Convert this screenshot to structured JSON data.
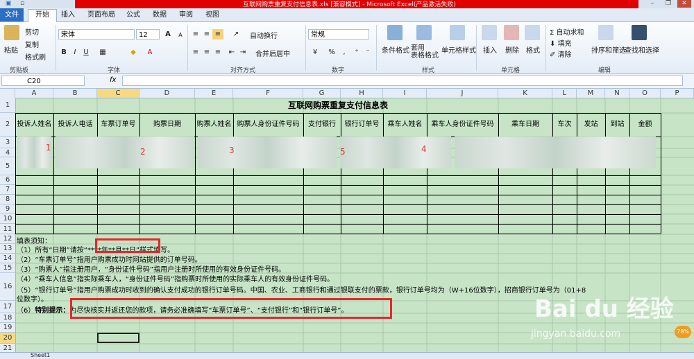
{
  "window": {
    "title": "互联网购票重复支付信息表.xls [兼容模式] - Microsoft Excel(产品激活失败)"
  },
  "tabs": [
    "文件",
    "开始",
    "插入",
    "页面布局",
    "公式",
    "数据",
    "审阅",
    "视图"
  ],
  "ribbon": {
    "clipboard": {
      "paste": "粘贴",
      "cut": "剪切",
      "copy": "复制",
      "format_painter": "格式刷",
      "label": "剪贴板"
    },
    "font": {
      "name": "宋体",
      "size": "12",
      "label": "字体",
      "bold": "B",
      "italic": "I",
      "underline": "U",
      "grow": "A",
      "shrink": "A"
    },
    "alignment": {
      "wrap": "自动换行",
      "merge": "合并后居中",
      "label": "对齐方式"
    },
    "number": {
      "format": "常规",
      "label": "数字",
      "percent": "%",
      "comma": ","
    },
    "styles": {
      "conditional": "条件格式",
      "table": "套用\n表格格式",
      "cell": "单元格样式",
      "label": "样式"
    },
    "cells": {
      "insert": "插入",
      "delete": "删除",
      "format": "格式",
      "label": "单元格"
    },
    "editing": {
      "autosum": "自动求和",
      "fill": "填充",
      "clear": "清除",
      "sort": "排序和筛选",
      "find": "查找和选择",
      "label": "编辑"
    }
  },
  "formula_bar": {
    "name_box": "C20",
    "fx": "fx",
    "value": ""
  },
  "columns": [
    "A",
    "B",
    "C",
    "D",
    "E",
    "F",
    "G",
    "H",
    "I",
    "J",
    "K",
    "L",
    "M",
    "N",
    "O",
    "P"
  ],
  "rows": [
    "1",
    "2",
    "3",
    "4",
    "5",
    "6",
    "7",
    "8",
    "9",
    "10",
    "11",
    "12",
    "13",
    "14",
    "15",
    "16",
    "17",
    "18",
    "19",
    "20",
    "21"
  ],
  "sheet": {
    "title": "互联网购票重复支付信息表",
    "headers": [
      "投诉人姓名",
      "投诉人电话",
      "车票订单号",
      "购票日期",
      "购票人姓名",
      "购票人身份证件号码",
      "支付银行",
      "银行订单号",
      "乘车人姓名",
      "乘车人身份证件号码",
      "乘车日期",
      "车次",
      "发站",
      "到站",
      "金额"
    ],
    "markers": [
      "1",
      "2",
      "3",
      "5",
      "4"
    ],
    "notes": {
      "heading": "填表须知：",
      "n1": "（1）所有“日期”请按“****年**月**日”样式填写。",
      "n2": "（2）“车票订单号”指用户购票成功时网站提供的订单号码。",
      "n3": "（3）“购票人”指注册用户，“身份证件号码”指用户注册时所使用的有效身份证件号码。",
      "n4": "（4）“乘车人信息”指实际乘车人，“身份证件号码”指购票时所使用的实际乘车人的有效身份证件号码。",
      "n5a": "（5）“银行订单号”指用户购票成功时收到的确认支付成功的银行订单号码。中国、农业、工商银行和通过银联支付的票款，银行订单号均为（W+16位数字），招商银行订单号为（01+8",
      "n5b": "位数字）。",
      "n6_prefix": "（6）",
      "n6_bold": "特别提示：",
      "n6_text": "为尽快核实并返还您的款项，请务必准确填写“车票订单号”、“支付银行”和“银行订单号”。"
    }
  },
  "sheet_tab": "Sheet1",
  "watermark": {
    "brand": "Bai du 经验",
    "url": "jingyan.baidu.com",
    "badge": "78%"
  }
}
